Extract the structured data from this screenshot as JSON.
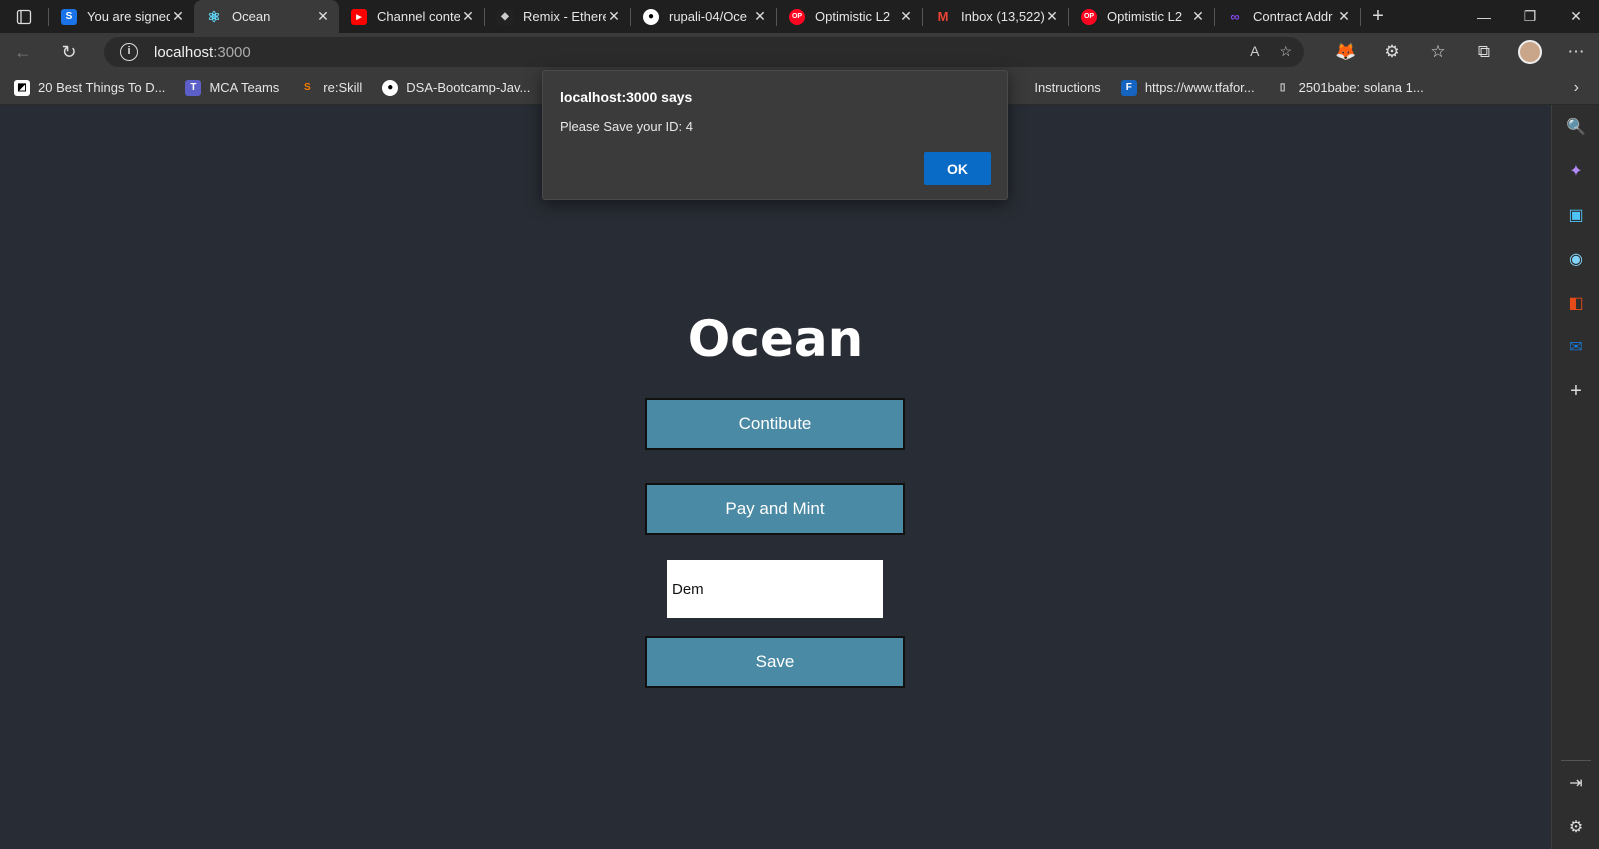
{
  "tabs": [
    {
      "title": "You are signed",
      "favicon": "S",
      "color": "#1a73e8"
    },
    {
      "title": "Ocean",
      "favicon": "react-icon",
      "color": "#61dafb"
    },
    {
      "title": "Channel conte",
      "favicon": "youtube-icon",
      "color": "#ff0000"
    },
    {
      "title": "Remix - Ethere",
      "favicon": "remix-icon",
      "color": "#222222"
    },
    {
      "title": "rupali-04/Oce",
      "favicon": "github-icon",
      "color": "#ffffff"
    },
    {
      "title": "Optimistic L2",
      "favicon": "OP",
      "color": "#ff0420"
    },
    {
      "title": "Inbox (13,522)",
      "favicon": "M",
      "color": "#ea4335"
    },
    {
      "title": "Optimistic L2",
      "favicon": "OP",
      "color": "#ff0420"
    },
    {
      "title": "Contract Addr",
      "favicon": "polygon-icon",
      "color": "#8247e5"
    }
  ],
  "address": {
    "host": "localhost",
    "port": ":3000"
  },
  "bookmarks": [
    {
      "label": "20 Best Things To D...",
      "icon": "bookmark-icon",
      "color": "#e6e6e6"
    },
    {
      "label": "MCA Teams",
      "icon": "teams-icon",
      "color": "#5b5fc7"
    },
    {
      "label": "re:Skill",
      "icon": "reskill-icon",
      "color": "#f57c00"
    },
    {
      "label": "DSA-Bootcamp-Jav...",
      "icon": "github-icon",
      "color": "#ffffff"
    },
    {
      "label": "Instructions",
      "icon": "",
      "color": "#e6e6e6"
    },
    {
      "label": "https://www.tfafor...",
      "icon": "F",
      "color": "#1565c0"
    },
    {
      "label": "2501babe: solana 1...",
      "icon": "doc-icon",
      "color": "#e6e6e6"
    }
  ],
  "app": {
    "title": "Ocean",
    "contribute_label": "Contibute",
    "pay_mint_label": "Pay and Mint",
    "name_value": "Dem",
    "save_label": "Save"
  },
  "dialog": {
    "title": "localhost:3000 says",
    "message": "Please Save your ID: 4",
    "ok_label": "OK"
  }
}
